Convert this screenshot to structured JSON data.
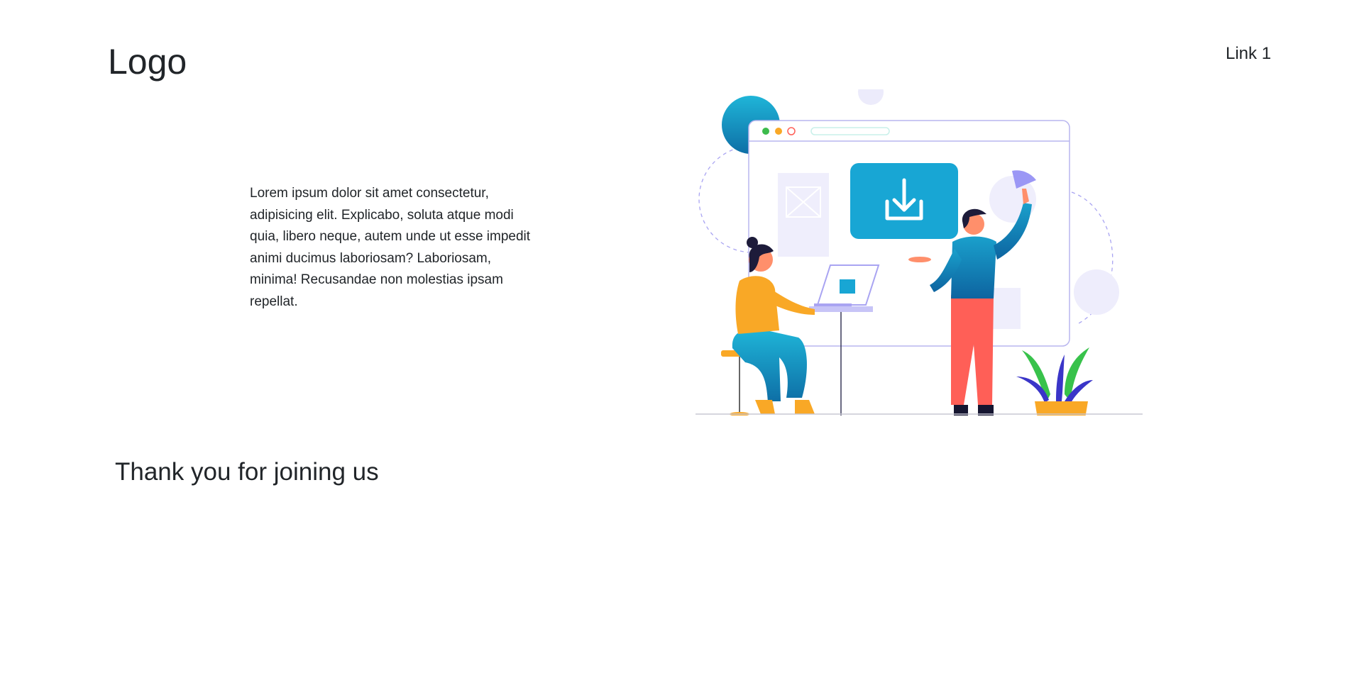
{
  "header": {
    "logo_text": "Logo",
    "nav_links": [
      "Link 1"
    ]
  },
  "hero": {
    "paragraph": "Lorem ipsum dolor sit amet consectetur, adipisicing elit. Explicabo, soluta atque modi quia, libero neque, autem unde ut esse impedit animi ducimus laboriosam? Laboriosam, minima! Recusandae non molestias ipsam repellat.",
    "illustration_icon": "download-icon"
  },
  "footer_section": {
    "heading": "Thank you for joining us"
  },
  "colors": {
    "text": "#212529",
    "accent_blue": "#18a6d4",
    "accent_orange": "#f9a826",
    "accent_coral": "#ff5f57",
    "accent_purple": "#9b97f5",
    "plant_green": "#38c24b"
  }
}
